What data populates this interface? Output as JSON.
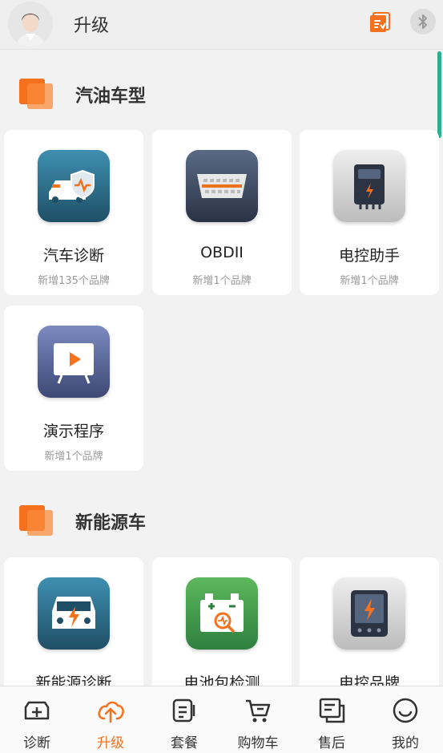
{
  "header": {
    "title": "升级",
    "doc_icon": "document-sync-icon",
    "bluetooth_icon": "bluetooth-icon"
  },
  "colors": {
    "accent": "#f5711e",
    "scroll_indicator": "#2bb08e"
  },
  "sections": [
    {
      "title": "汽油车型",
      "items": [
        {
          "name": "汽车诊断",
          "sub": "新增135个品牌",
          "icon": "car-shield-icon"
        },
        {
          "name": "OBDII",
          "sub": "新增1个品牌",
          "icon": "obd-connector-icon"
        },
        {
          "name": "电控助手",
          "sub": "新增1个品牌",
          "icon": "ecu-device-icon"
        },
        {
          "name": "演示程序",
          "sub": "新增1个品牌",
          "icon": "play-demo-icon"
        }
      ]
    },
    {
      "title": "新能源车",
      "items": [
        {
          "name": "新能源诊断",
          "icon": "ev-car-icon"
        },
        {
          "name": "电池包检测",
          "icon": "battery-check-icon"
        },
        {
          "name": "电控品牌",
          "icon": "ecu-brand-icon"
        }
      ]
    }
  ],
  "nav": [
    {
      "label": "诊断",
      "icon": "diagnose-icon"
    },
    {
      "label": "升级",
      "icon": "cloud-upload-icon",
      "active": true
    },
    {
      "label": "套餐",
      "icon": "package-icon"
    },
    {
      "label": "购物车",
      "icon": "cart-icon"
    },
    {
      "label": "售后",
      "icon": "after-sales-icon"
    },
    {
      "label": "我的",
      "icon": "profile-icon"
    }
  ]
}
